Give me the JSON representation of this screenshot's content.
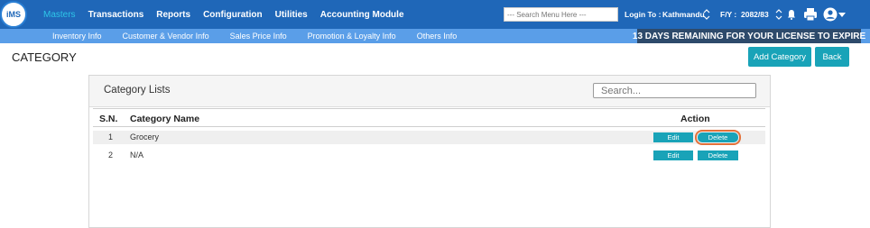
{
  "logo": {
    "text": "iMS"
  },
  "main_nav": [
    {
      "label": "Masters"
    },
    {
      "label": "Transactions"
    },
    {
      "label": "Reports"
    },
    {
      "label": "Configuration"
    },
    {
      "label": "Utilities"
    },
    {
      "label": "Accounting Module"
    }
  ],
  "header": {
    "search_menu_placeholder": "--- Search Menu Here ---",
    "login_label": "Login To :",
    "login_value": "Kathmandu",
    "fy_label": "F/Y :",
    "fy_value": "2082/83"
  },
  "sub_nav": [
    {
      "label": "Inventory Info"
    },
    {
      "label": "Customer & Vendor Info"
    },
    {
      "label": "Sales Price Info"
    },
    {
      "label": "Promotion & Loyalty Info"
    },
    {
      "label": "Others Info"
    }
  ],
  "license_notice": "13 DAYS REMAINING FOR YOUR LICENSE TO EXPIRE",
  "page": {
    "title": "CATEGORY",
    "add_button": "Add Category",
    "back_button": "Back"
  },
  "panel": {
    "title": "Category Lists",
    "search_placeholder": "Search..."
  },
  "table": {
    "headers": {
      "sn": "S.N.",
      "name": "Category Name",
      "action": "Action"
    },
    "rows": [
      {
        "sn": "1",
        "name": "Grocery",
        "edit": "Edit",
        "delete": "Delete"
      },
      {
        "sn": "2",
        "name": "N/A",
        "edit": "Edit",
        "delete": "Delete"
      }
    ]
  },
  "colors": {
    "topbar": "#1f67b8",
    "subbar": "#5a9ee8",
    "license_bg": "#2d4a6b",
    "accent": "#19a3b8",
    "highlight": "#e4713a"
  }
}
